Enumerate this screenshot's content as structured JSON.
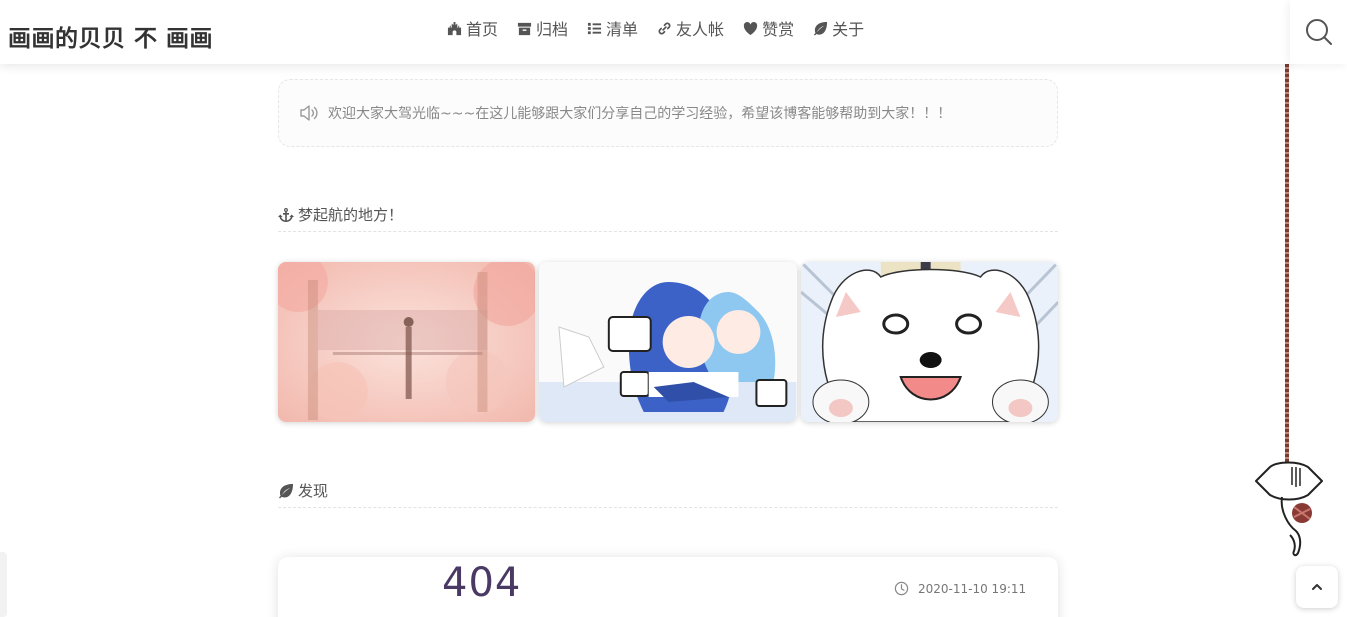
{
  "site": {
    "title": "画画的贝贝 不 画画"
  },
  "nav": [
    {
      "label": "首页",
      "icon": "castle-icon"
    },
    {
      "label": "归档",
      "icon": "archive-icon"
    },
    {
      "label": "清单",
      "icon": "list-icon"
    },
    {
      "label": "友人帐",
      "icon": "link-icon"
    },
    {
      "label": "赞赏",
      "icon": "heart-icon"
    },
    {
      "label": "关于",
      "icon": "leaf-icon"
    }
  ],
  "notice": {
    "icon": "speaker-icon",
    "text": "欢迎大家大驾光临~~~在这儿能够跟大家们分享自己的学习经验，希望该博客能够帮助到大家！！！"
  },
  "sections": {
    "features": {
      "icon": "anchor-icon",
      "title": "梦起航的地方！"
    },
    "discover": {
      "icon": "leaf-icon",
      "title": "发现"
    }
  },
  "features": [
    {
      "name": "cherry-blossom-illustration"
    },
    {
      "name": "anime-girls-illustration"
    },
    {
      "name": "white-dog-illustration"
    }
  ],
  "post": {
    "thumbnail_text": "404",
    "date": "2020-11-10 19:11",
    "date_icon": "clock-icon"
  },
  "controls": {
    "search_icon": "search-icon",
    "back_to_top_icon": "chevron-up-icon"
  },
  "colors": {
    "text": "#555555",
    "accent_404": "#4a3a63",
    "rope": "#7a3b30"
  }
}
